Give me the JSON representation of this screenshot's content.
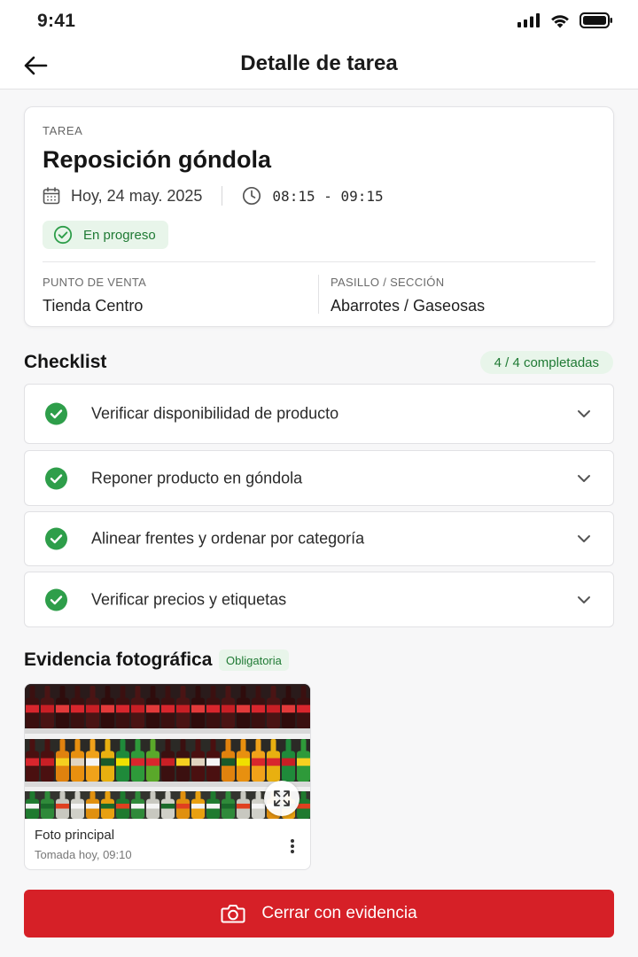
{
  "status_bar": {
    "time": "9:41",
    "icons": [
      "signal-icon",
      "wifi-icon",
      "battery-icon"
    ]
  },
  "header": {
    "title": "Detalle de tarea",
    "back_icon": "arrow-left-icon"
  },
  "task": {
    "label": "TAREA",
    "title": "Reposición góndola",
    "date": "Hoy, 24 may. 2025",
    "time_start": "08:15",
    "time_sep": "-",
    "time_end": "09:15",
    "status": "En progreso",
    "location": {
      "pos_label": "PUNTO DE VENTA",
      "pos_value": "Tienda Centro",
      "aisle_label": "PASILLO / SECCIÓN",
      "aisle_value": "Abarrotes / Gaseosas"
    }
  },
  "checklist": {
    "title": "Checklist",
    "count": "4 / 4 completadas",
    "items": [
      {
        "label": "Verificar disponibilidad de producto",
        "done": true
      },
      {
        "label": "Reponer producto en góndola",
        "done": true
      },
      {
        "label": "Alinear frentes y ordenar por categoría",
        "done": true
      },
      {
        "label": "Verificar precios y etiquetas",
        "done": true
      }
    ]
  },
  "evidence": {
    "title": "Evidencia fotográfica",
    "required": "Obligatoria",
    "photo": {
      "name": "Foto principal",
      "taken": "Tomada hoy, 09:10"
    }
  },
  "cta": {
    "label": "Cerrar con evidencia",
    "icon": "camera-icon"
  },
  "colors": {
    "accent_red": "#d62027",
    "success_green": "#2e9e4a",
    "success_bg": "#e8f5ea",
    "success_text": "#1f7a34"
  }
}
